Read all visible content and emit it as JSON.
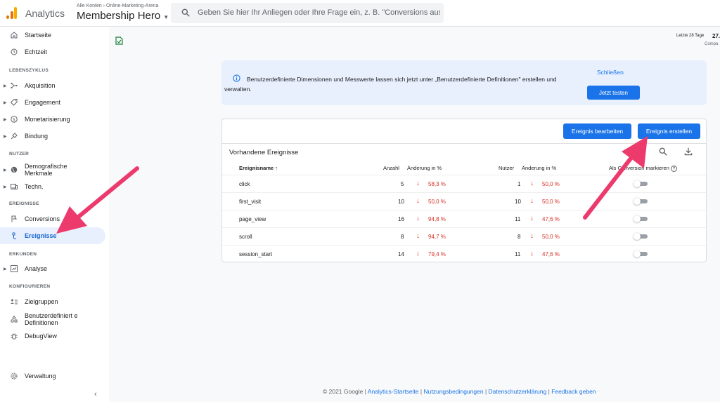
{
  "header": {
    "brand": "Analytics",
    "breadcrumb": "Alle Konten › Online-Marketing-Arena",
    "property": "Membership Hero",
    "search_placeholder": "Geben Sie hier Ihr Anliegen oder Ihre Frage ein, z. B. \"Conversions aus der…"
  },
  "sidebar": {
    "home": "Startseite",
    "realtime": "Echtzeit",
    "lifecycle": "LEBENSZYKLUS",
    "acquisition": "Akquisition",
    "engagement": "Engagement",
    "monetization": "Monetarisierung",
    "retention": "Bindung",
    "user_section": "NUTZER",
    "demographics": "Demografische Merkmale",
    "tech": "Techn.",
    "events_section": "EREIGNISSE",
    "conversions": "Conversions",
    "events": "Ereignisse",
    "explore_section": "ERKUNDEN",
    "analysis": "Analyse",
    "configure_section": "KONFIGURIEREN",
    "audiences": "Zielgruppen",
    "custom_definitions": "Benutzerdefiniert e Definitionen",
    "debugview": "DebugView",
    "admin": "Verwaltung",
    "collapse": "‹"
  },
  "toolbar": {
    "daterange": "Letzte 28 Tage",
    "date": "27.",
    "compare": "Compa"
  },
  "banner": {
    "text": "Benutzerdefinierte Dimensionen und Messwerte lassen sich jetzt unter „Benutzerdefinierte Definitionen\" erstellen und verwalten.",
    "close": "Schließen",
    "try": "Jetzt testen"
  },
  "events_card": {
    "edit_button": "Ereignis bearbeiten",
    "create_button": "Ereignis erstellen",
    "title": "Vorhandene Ereignisse",
    "headers": {
      "name": "Ereignisname",
      "sort": "↑",
      "count": "Anzahl",
      "change_count": "Änderung in %",
      "users": "Nutzer",
      "change_users": "Änderung in %",
      "conversion": "Als Conversion markieren",
      "help": "?"
    },
    "rows": [
      {
        "name": "click",
        "count": "5",
        "count_change": "58,3 %",
        "users": "1",
        "users_change": "50,0 %"
      },
      {
        "name": "first_visit",
        "count": "10",
        "count_change": "50,0 %",
        "users": "10",
        "users_change": "50,0 %"
      },
      {
        "name": "page_view",
        "count": "16",
        "count_change": "94,8 %",
        "users": "11",
        "users_change": "47,6 %"
      },
      {
        "name": "scroll",
        "count": "8",
        "count_change": "94,7 %",
        "users": "8",
        "users_change": "50,0 %"
      },
      {
        "name": "session_start",
        "count": "14",
        "count_change": "79,4 %",
        "users": "11",
        "users_change": "47,6 %"
      }
    ],
    "down_arrow": "↓"
  },
  "footer": {
    "copyright": "© 2021 Google |",
    "home": "Analytics-Startseite",
    "sep1": "|",
    "terms": "Nutzungsbedingungen",
    "sep2": "|",
    "privacy": "Datenschutzerklärung",
    "sep3": "|",
    "feedback": "Feedback geben"
  },
  "colors": {
    "accent": "#1a73e8",
    "negative": "#d93025",
    "annotation": "#ec3a6d"
  }
}
